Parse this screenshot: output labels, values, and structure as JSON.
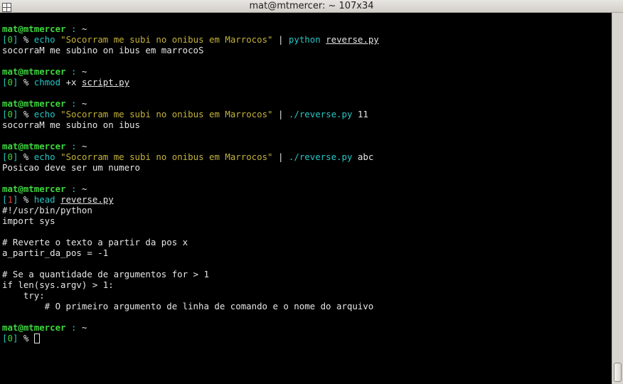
{
  "window": {
    "title": "mat@mtmercer: ~ 107x34",
    "icon": "terminal-window-icon"
  },
  "prompt": {
    "user": "mat@mtmercer",
    "sep": " : ",
    "dir": "~",
    "pct": " % "
  },
  "colors": {
    "green": "#3fd63f",
    "cyan": "#27c6c6",
    "yellow": "#c4b23a",
    "red": "#e03c3c",
    "fg": "#e6e6e6",
    "bg": "#000000"
  },
  "blocks": [
    {
      "status": "0",
      "cmd": "echo",
      "arg_string": "\"Socorram me subi no onibus em Marrocos\"",
      "pipe": "|",
      "exec": "python",
      "file": "reverse.py",
      "extra": "",
      "output": [
        "socorraM me subino on ibus em marrocoS"
      ]
    },
    {
      "status": "0",
      "cmd": "chmod",
      "arg_plain": "+x",
      "file": "script.py",
      "output": []
    },
    {
      "status": "0",
      "cmd": "echo",
      "arg_string": "\"Socorram me subi no onibus em Marrocos\"",
      "pipe": "|",
      "exec": "./reverse.py",
      "extra": "11",
      "output": [
        "socorraM me subino on ibus"
      ]
    },
    {
      "status": "0",
      "cmd": "echo",
      "arg_string": "\"Socorram me subi no onibus em Marrocos\"",
      "pipe": "|",
      "exec": "./reverse.py",
      "extra": "abc",
      "output": [
        "Posicao deve ser um numero"
      ]
    },
    {
      "status": "1",
      "cmd": "head",
      "file": "reverse.py",
      "output": [
        "#!/usr/bin/python",
        "import sys",
        "",
        "# Reverte o texto a partir da pos x",
        "a_partir_da_pos = -1",
        "",
        "# Se a quantidade de argumentos for > 1",
        "if len(sys.argv) > 1:",
        "    try:",
        "        # O primeiro argumento de linha de comando e o nome do arquivo"
      ]
    },
    {
      "status": "0"
    }
  ]
}
